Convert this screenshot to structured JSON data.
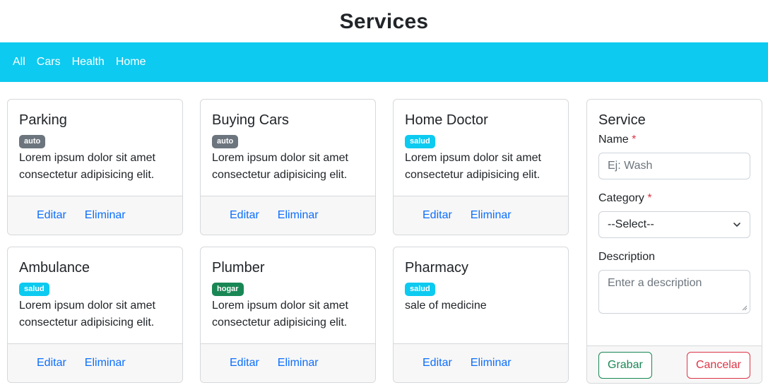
{
  "page": {
    "title": "Services"
  },
  "nav": {
    "items": [
      "All",
      "Cars",
      "Health",
      "Home"
    ]
  },
  "cards": [
    {
      "title": "Parking",
      "badge": "auto",
      "text": "Lorem ipsum dolor sit amet consectetur adipisicing elit.",
      "edit": "Editar",
      "delete": "Eliminar"
    },
    {
      "title": "Buying Cars",
      "badge": "auto",
      "text": "Lorem ipsum dolor sit amet consectetur adipisicing elit.",
      "edit": "Editar",
      "delete": "Eliminar"
    },
    {
      "title": "Home Doctor",
      "badge": "salud",
      "text": "Lorem ipsum dolor sit amet consectetur adipisicing elit.",
      "edit": "Editar",
      "delete": "Eliminar"
    },
    {
      "title": "Ambulance",
      "badge": "salud",
      "text": "Lorem ipsum dolor sit amet consectetur adipisicing elit.",
      "edit": "Editar",
      "delete": "Eliminar"
    },
    {
      "title": "Plumber",
      "badge": "hogar",
      "text": "Lorem ipsum dolor sit amet consectetur adipisicing elit.",
      "edit": "Editar",
      "delete": "Eliminar"
    },
    {
      "title": "Pharmacy",
      "badge": "salud",
      "text": "sale of medicine",
      "edit": "Editar",
      "delete": "Eliminar"
    }
  ],
  "form": {
    "title": "Service",
    "name_label": "Name",
    "name_placeholder": "Ej: Wash",
    "category_label": "Category",
    "category_selected": "--Select--",
    "description_label": "Description",
    "description_placeholder": "Enter a description",
    "required_mark": "*",
    "save_label": "Grabar",
    "cancel_label": "Cancelar"
  },
  "colors": {
    "navbar": "#0dcaf0",
    "link": "#0d6efd",
    "badge_auto": "#6c757d",
    "badge_salud": "#0dcaf0",
    "badge_hogar": "#198754",
    "success": "#198754",
    "danger": "#dc3545"
  },
  "icons": {
    "select": "chevron-down-icon",
    "textarea": "resize-grip-icon"
  }
}
